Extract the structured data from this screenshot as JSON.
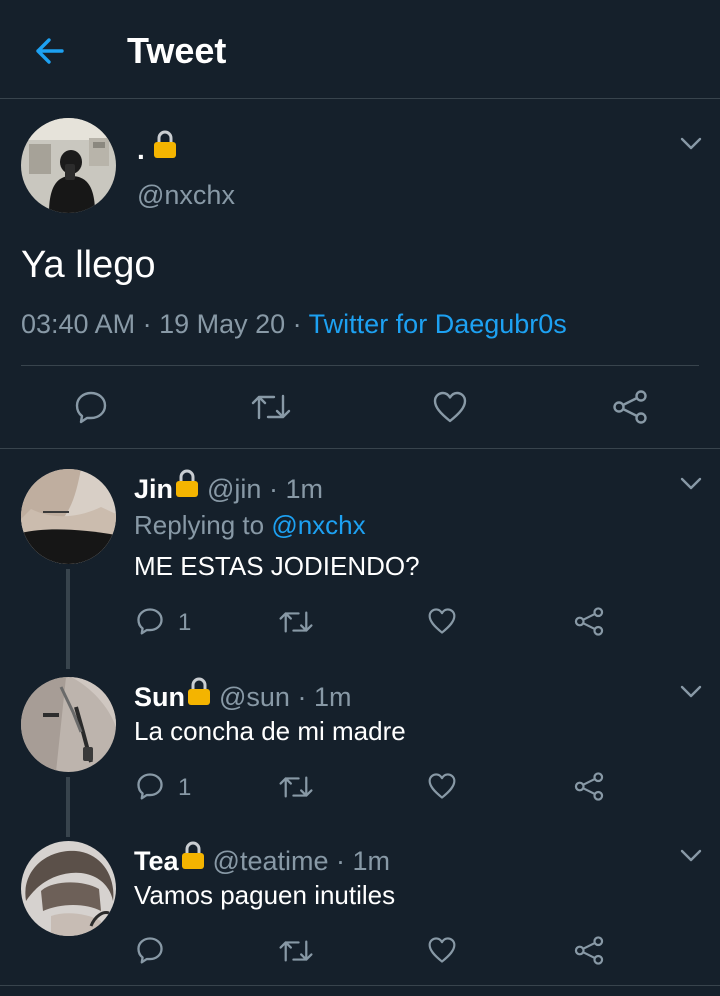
{
  "header": {
    "title": "Tweet"
  },
  "main_tweet": {
    "display_name": ".",
    "handle": "@nxchx",
    "text": "Ya llego",
    "time": "03:40 AM",
    "separator": " · ",
    "date": "19 May 20",
    "source": "Twitter for Daegubr0s"
  },
  "replies": [
    {
      "name": "Jin",
      "handle": "@jin",
      "sep": " · ",
      "time": "1m",
      "replying_prefix": "Replying to ",
      "replying_to": "@nxchx",
      "text": "ME ESTAS JODIENDO?",
      "reply_count": "1"
    },
    {
      "name": "Sun",
      "handle": "@sun",
      "sep": " · ",
      "time": "1m",
      "text": "La concha de mi madre",
      "reply_count": "1"
    },
    {
      "name": "Tea",
      "handle": "@teatime",
      "sep": " · ",
      "time": "1m",
      "text": "Vamos paguen inutiles",
      "reply_count": ""
    }
  ],
  "colors": {
    "background": "#15202b",
    "accent": "#1da1f2",
    "muted": "#8899a6",
    "divider": "#38444d",
    "lock": "#f4b400"
  },
  "icons": [
    "back-arrow-icon",
    "lock-icon",
    "chevron-down-icon",
    "reply-icon",
    "retweet-icon",
    "like-icon",
    "share-icon"
  ]
}
